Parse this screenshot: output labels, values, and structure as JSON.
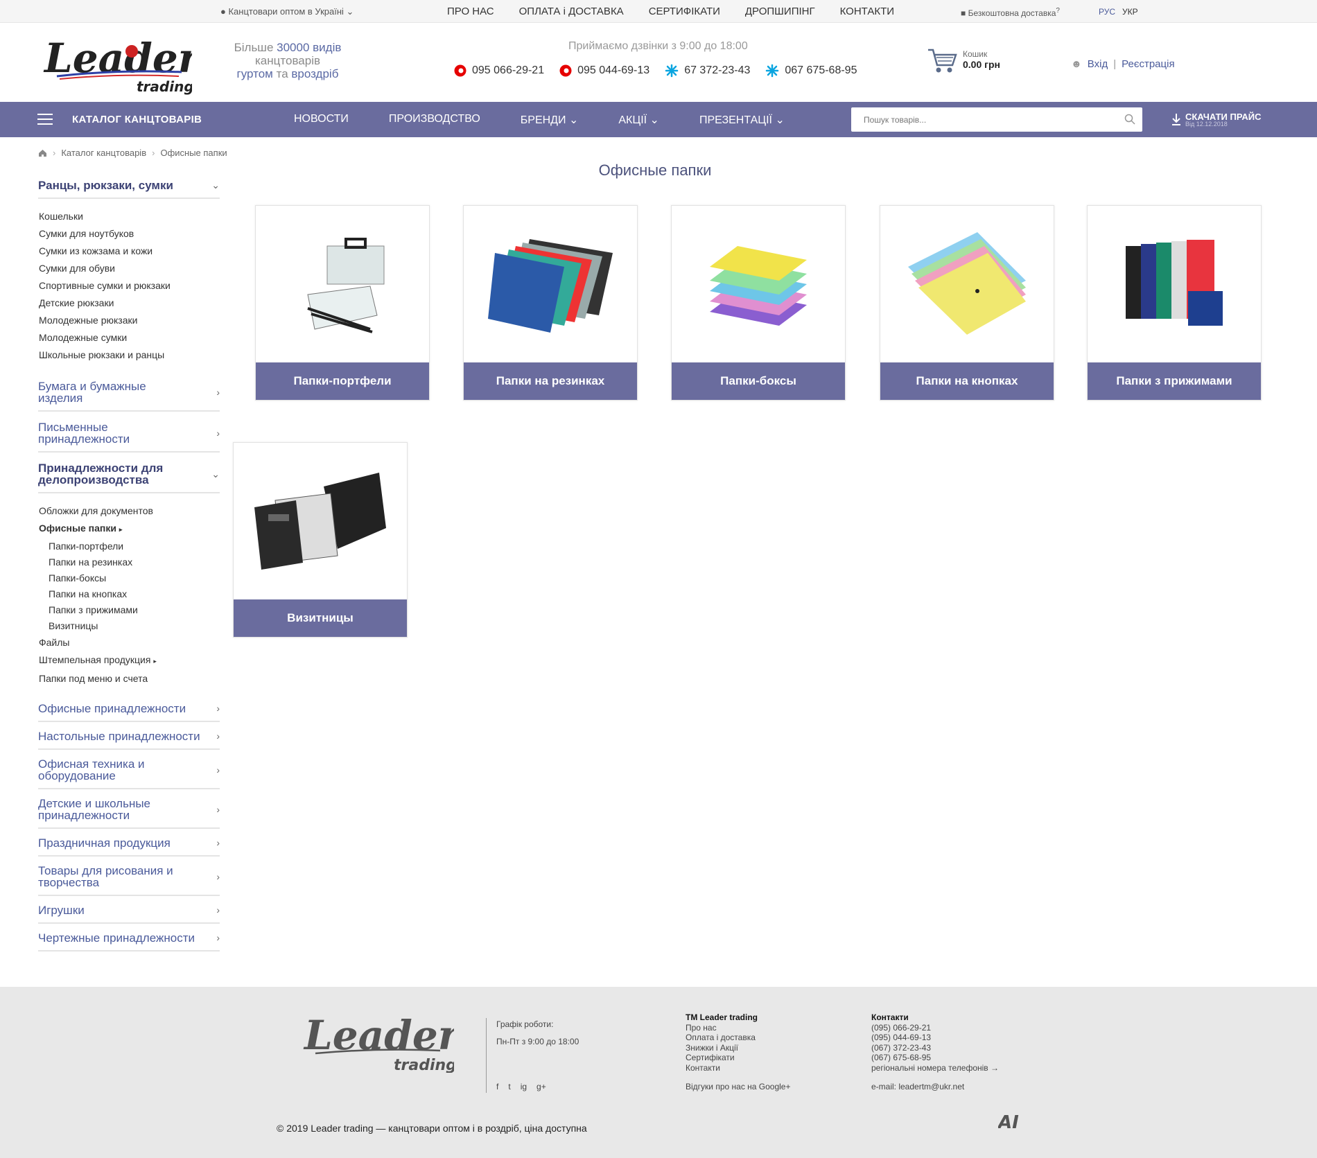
{
  "topbar": {
    "region": "Канцтовари оптом в Україні",
    "nav": [
      "ПРО НАС",
      "ОПЛАТА і ДОСТАВКА",
      "СЕРТИФІКАТИ",
      "ДРОПШИПІНГ",
      "КОНТАКТИ"
    ],
    "delivery": "Безкоштовна доставка",
    "delivery_mark": "?",
    "langs": [
      "РУС",
      "УКР"
    ]
  },
  "header": {
    "logo_word": "Leader",
    "logo_sub": "trading",
    "slogan_1": "Більше",
    "slogan_2": "30000 видів",
    "slogan_3": "канцтоварів",
    "slogan_4": "гуртом",
    "slogan_5": "та",
    "slogan_6": "вроздріб",
    "calls": "Приймаємо дзвінки з 9:00 до 18:00",
    "phones": [
      {
        "op": "vodafone",
        "num": "095 066-29-21"
      },
      {
        "op": "vodafone",
        "num": "095 044-69-13"
      },
      {
        "op": "kyivstar",
        "num": "67 372-23-43"
      },
      {
        "op": "kyivstar",
        "num": "067 675-68-95"
      }
    ],
    "cart_label": "Кошик",
    "cart_sum": "0.00 грн",
    "login": "Вхід",
    "register": "Реєстрація"
  },
  "navbar": {
    "catalog": "КАТАЛОГ КАНЦТОВАРІВ",
    "items": [
      {
        "label": "НОВОСТИ",
        "drop": ""
      },
      {
        "label": "ПРОИЗВОДСТВО",
        "drop": ""
      },
      {
        "label": "БРЕНДИ",
        "drop": "⌄"
      },
      {
        "label": "АКЦІЇ",
        "drop": "⌄"
      },
      {
        "label": "ПРЕЗЕНТАЦІЇ",
        "drop": "⌄"
      }
    ],
    "search_placeholder": "Пошук товарів...",
    "price_title": "СКАЧАТИ ПРАЙС",
    "price_date": "Від 12.12.2018"
  },
  "breadcrumb": [
    "Каталог канцтоварів",
    "Офисные папки"
  ],
  "page_title": "Офисные папки",
  "sidebar": [
    {
      "label": "Ранцы, рюкзаки, сумки",
      "open": true,
      "sub": [
        "Кошельки",
        "Сумки для ноутбуков",
        "Сумки из кожзама и кожи",
        "Сумки для обуви",
        "Спортивные сумки и рюкзаки",
        "Детские рюкзаки",
        "Молодежные рюкзаки",
        "Молодежные сумки",
        "Школьные рюкзаки и ранцы"
      ]
    },
    {
      "label": "Бумага и бумажные изделия"
    },
    {
      "label": "Письменные принадлежности"
    },
    {
      "label": "Принадлежности для делопроизводства",
      "open": true,
      "sub": [
        "Обложки для документов",
        "Офисные папки",
        "Папки-портфели",
        "Папки на резинках",
        "Папки-боксы",
        "Папки на кнопках",
        "Папки з прижимами",
        "Визитницы",
        "Файлы",
        "Штемпельная продукция",
        "Папки под меню и счета"
      ]
    },
    {
      "label": "Офисные принадлежности"
    },
    {
      "label": "Настольные принадлежности"
    },
    {
      "label": "Офисная техника и оборудование"
    },
    {
      "label": "Детские и школьные принадлежности"
    },
    {
      "label": "Праздничная продукция"
    },
    {
      "label": "Товары для рисования и творчества"
    },
    {
      "label": "Игрушки"
    },
    {
      "label": "Чертежные принадлежности"
    }
  ],
  "products": [
    "Папки-портфели",
    "Папки на резинках",
    "Папки-боксы",
    "Папки на кнопках",
    "Папки з прижимами",
    "Визитницы"
  ],
  "footer": {
    "logo_word": "Leader",
    "logo_sub": "trading",
    "hours_title": "Графік роботи:",
    "hours": "Пн-Пт з 9:00 до 18:00",
    "col1_title": "ТМ Leader trading",
    "col1": [
      "Про нас",
      "Оплата і доставка",
      "Знижки і Акції",
      "Сертифікати",
      "Контакти"
    ],
    "reviews": "Відгуки про нас на Google+",
    "col2_title": "Контакти",
    "col2": [
      "(095) 066-29-21",
      "(095) 044-69-13",
      "(067) 372-23-43",
      "(067) 675-68-95",
      "регіональні номера телефонів →"
    ],
    "email": "e-mail: leadertm@ukr.net",
    "copyright": "© 2019 Leader trading — канцтовари оптом і в роздріб, ціна доступна",
    "social": [
      "facebook-icon",
      "twitter-icon",
      "instagram-icon",
      "googleplus-icon"
    ],
    "social_glyphs": [
      "f",
      "t",
      "ig",
      "g+"
    ],
    "dev_mark": "AI"
  },
  "colors": {
    "nav": "#6a6c9e",
    "link": "#4a5a9a",
    "footer": "#e8e8e8"
  }
}
